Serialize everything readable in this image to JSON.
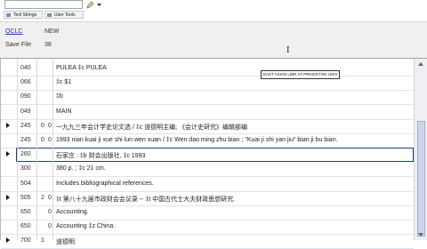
{
  "toolbar": {
    "buttons": [
      {
        "label": "Text Strings"
      },
      {
        "label": "User Tools"
      }
    ]
  },
  "header": {
    "oclc_label": "OCLC",
    "oclc_status": "NEW",
    "save_file_label": "Save File",
    "save_file_value": "38"
  },
  "tooltip": "EAST ASIAN LIBR AT PRINCETON UNIV",
  "records": [
    {
      "tag": "040",
      "ind1": "",
      "ind2": "",
      "value": "PULEA ‡c PULEA",
      "arrow": false,
      "selected": false
    },
    {
      "tag": "066",
      "ind1": "",
      "ind2": "",
      "value": "‡c $1",
      "arrow": false,
      "selected": false
    },
    {
      "tag": "090",
      "ind1": "",
      "ind2": "",
      "value": "‡b",
      "arrow": false,
      "selected": false
    },
    {
      "tag": "049",
      "ind1": "",
      "ind2": "",
      "value": "MAIN",
      "arrow": false,
      "selected": false
    },
    {
      "tag": "245",
      "ind1": "0",
      "ind2": "0",
      "value": "一九九三年会计学史论文选 / ‡c 道德明主编; 《会计史研究》编辑部编",
      "arrow": true,
      "selected": false
    },
    {
      "tag": "245",
      "ind1": "0",
      "ind2": "0",
      "value": "1993 nian kuai ji xue shi lun wen xuan / ‡c Wen dao ming zhu bian ; \"Kuai ji shi yan jiu\" bian ji bu bian.",
      "arrow": false,
      "selected": false
    },
    {
      "tag": "260",
      "ind1": "",
      "ind2": "",
      "value": "石家庄 : ‡b 财会出版社, ‡c 1993",
      "arrow": true,
      "selected": true
    },
    {
      "tag": "300",
      "ind1": "",
      "ind2": "",
      "value": "380 p. ; ‡c 21 cm.",
      "arrow": false,
      "selected": false
    },
    {
      "tag": "504",
      "ind1": "",
      "ind2": "",
      "value": "Includes bibliographical references.",
      "arrow": false,
      "selected": false
    },
    {
      "tag": "505",
      "ind1": "2",
      "ind2": "0",
      "value": "‡t 第八十九届市政财会会议录 -- ‡t 中国古代士大夫财政思想研究.",
      "arrow": true,
      "selected": false
    },
    {
      "tag": "650",
      "ind1": "",
      "ind2": "0",
      "value": "Accounting.",
      "arrow": false,
      "selected": false
    },
    {
      "tag": "650",
      "ind1": "",
      "ind2": "0",
      "value": "Accounting ‡z China.",
      "arrow": false,
      "selected": false
    },
    {
      "tag": "700",
      "ind1": "1",
      "ind2": "",
      "value": "道德明",
      "arrow": true,
      "selected": false
    }
  ]
}
